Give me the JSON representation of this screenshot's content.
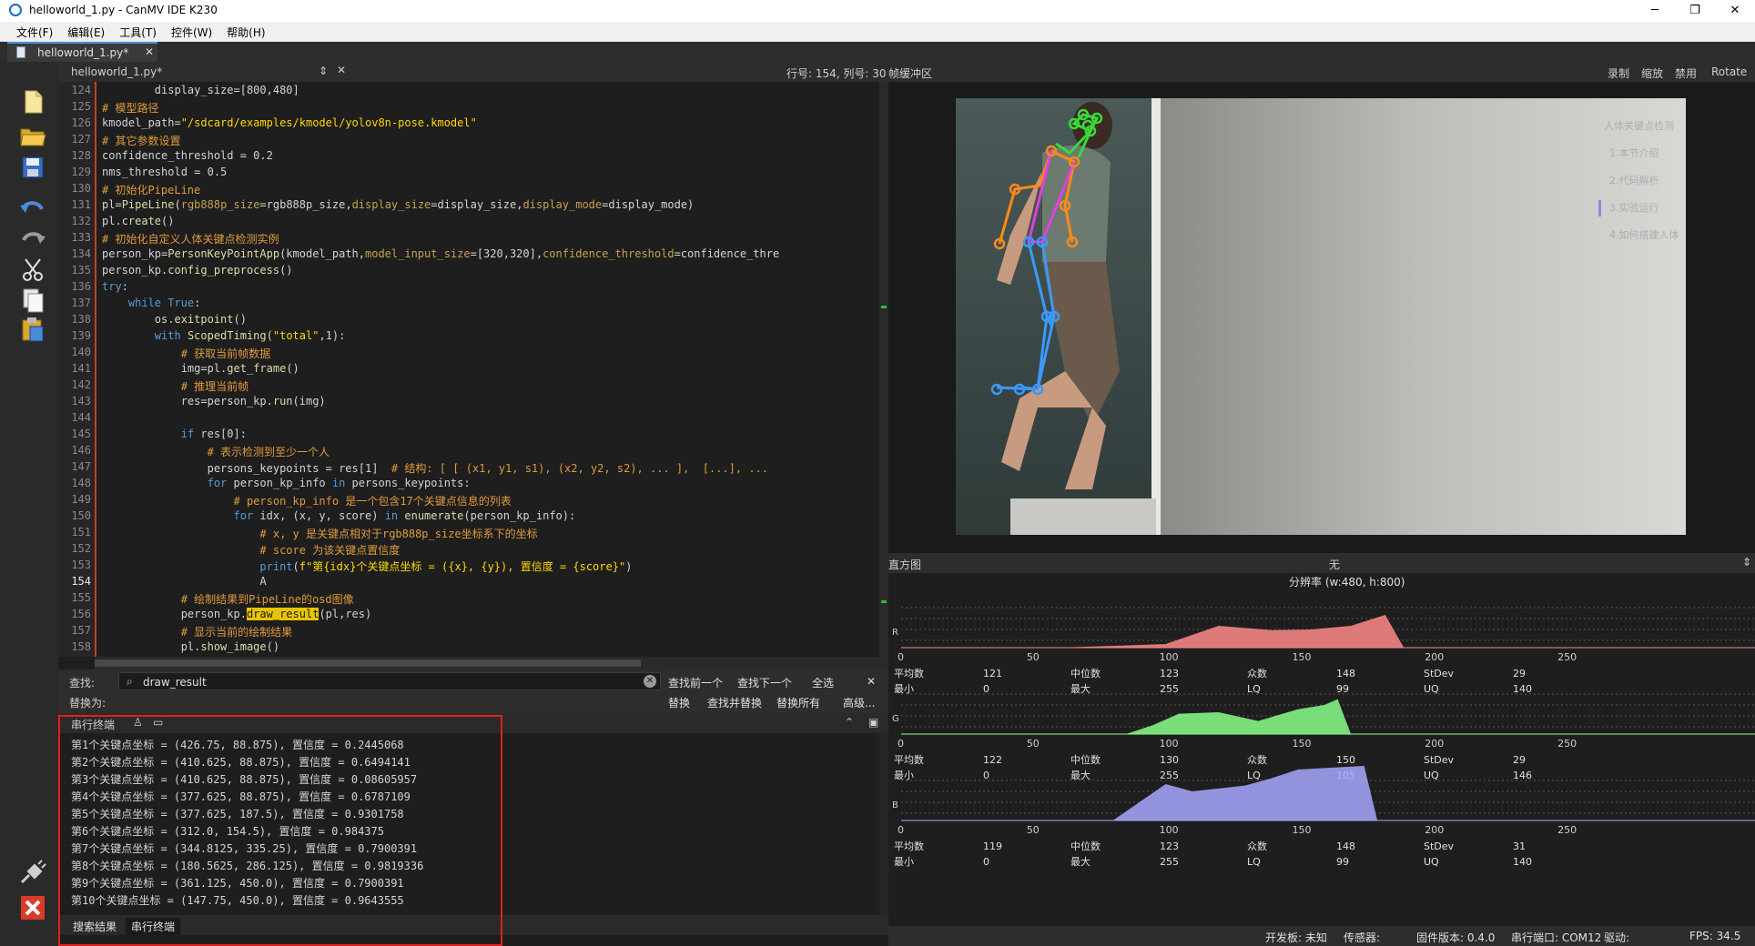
{
  "window": {
    "title": "helloworld_1.py - CanMV IDE K230",
    "minimize": "─",
    "maximize": "❐",
    "close": "✕"
  },
  "menu": [
    "文件(F)",
    "编辑(E)",
    "工具(T)",
    "控件(W)",
    "帮助(H)"
  ],
  "tab": {
    "label": "helloworld_1.py*",
    "close": "✕"
  },
  "editor": {
    "header_file": "helloworld_1.py*",
    "header_arrows": "⇕",
    "header_close": "✕",
    "cursor_position": "行号: 154, 列号: 30",
    "current_line": 154,
    "line_numbers": [
      124,
      125,
      126,
      127,
      128,
      129,
      130,
      131,
      132,
      133,
      134,
      135,
      136,
      137,
      138,
      139,
      140,
      141,
      142,
      143,
      144,
      145,
      146,
      147,
      148,
      149,
      150,
      151,
      152,
      153,
      154,
      155,
      156,
      157,
      158
    ]
  },
  "find": {
    "find_label": "查找:",
    "replace_label": "替换为:",
    "query": "draw_result",
    "search_icon": "search-icon",
    "clear": "✕",
    "find_prev": "查找前一个",
    "find_next": "查找下一个",
    "select_all": "全选",
    "close": "✕",
    "replace": "替换",
    "find_replace": "查找并替换",
    "replace_all": "替换所有",
    "advanced": "高级..."
  },
  "terminal": {
    "title": "串行终端",
    "lines": [
      "第1个关键点坐标 = (426.75, 88.875), 置信度 = 0.2445068",
      "第2个关键点坐标 = (410.625, 88.875), 置信度 = 0.6494141",
      "第3个关键点坐标 = (410.625, 88.875), 置信度 = 0.08605957",
      "第4个关键点坐标 = (377.625, 88.875), 置信度 = 0.6787109",
      "第5个关键点坐标 = (377.625, 187.5), 置信度 = 0.9301758",
      "第6个关键点坐标 = (312.0, 154.5), 置信度 = 0.984375",
      "第7个关键点坐标 = (344.8125, 335.25), 置信度 = 0.7900391",
      "第8个关键点坐标 = (180.5625, 286.125), 置信度 = 0.9819336",
      "第9个关键点坐标 = (361.125, 450.0), 置信度 = 0.7900391",
      "第10个关键点坐标 = (147.75, 450.0), 置信度 = 0.9643555"
    ],
    "tab_search": "搜索结果",
    "tab_serial": "串行终端"
  },
  "framebuffer": {
    "title": "帧缓冲区",
    "record": "录制",
    "zoom": "缩放",
    "disable": "禁用",
    "rotate": "Rotate",
    "page_lines": [
      "人体关键点检测",
      "1.本节介绍",
      "2.代码解析",
      "3.实验运行",
      "4.如何搭建人体"
    ]
  },
  "histogram": {
    "title": "直方图",
    "mode": "无",
    "resolution": "分辨率 (w:480, h:800)",
    "ticks": [
      "0",
      "50",
      "100",
      "150",
      "200",
      "250"
    ],
    "channels": [
      {
        "name": "R",
        "color": "#ff8a8a",
        "mean": "121",
        "median": "123",
        "mode": "148",
        "stdev": "29",
        "min": "0",
        "max": "255",
        "lq": "99",
        "uq": "140"
      },
      {
        "name": "G",
        "color": "#8aff8a",
        "mean": "122",
        "median": "130",
        "mode": "150",
        "stdev": "29",
        "min": "0",
        "max": "255",
        "lq": "105",
        "uq": "146"
      },
      {
        "name": "B",
        "color": "#a8a8ff",
        "mean": "119",
        "median": "123",
        "mode": "148",
        "stdev": "31",
        "min": "0",
        "max": "255",
        "lq": "99",
        "uq": "140"
      }
    ],
    "labels": {
      "mean": "平均数",
      "median": "中位数",
      "mode": "众数",
      "stdev": "StDev",
      "min": "最小",
      "max": "最大",
      "lq": "LQ",
      "uq": "UQ"
    }
  },
  "status": {
    "board": "开发板: 未知",
    "sensor": "传感器:",
    "firmware": "固件版本: 0.4.0",
    "port": "串行端口: COM12",
    "driver": "驱动:",
    "fps": "FPS: 34.5"
  }
}
